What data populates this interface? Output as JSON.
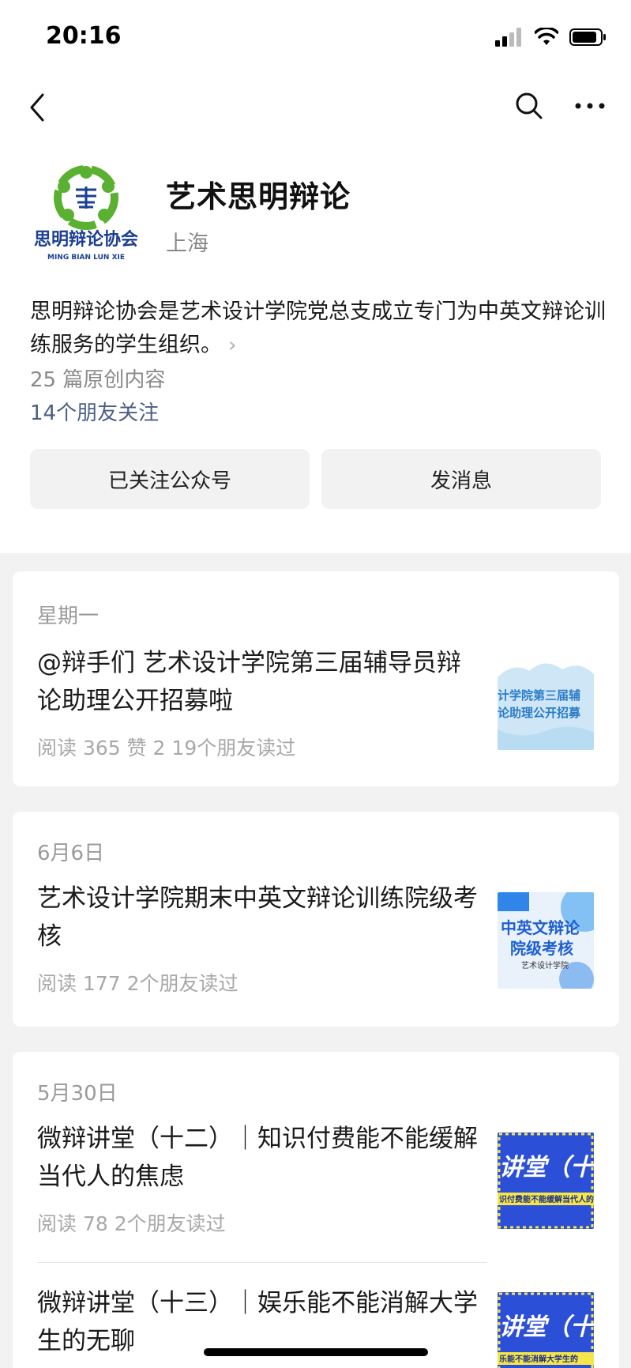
{
  "status_bar": {
    "time": "20:16"
  },
  "account": {
    "name": "艺术思明辩论",
    "region": "上海",
    "logo_text": "思明辩论协会",
    "logo_subtext": "MING BIAN LUN XIE",
    "description": "思明辩论协会是艺术设计学院党总支成立专门为中英文辩论训练服务的学生组织。",
    "original_count": "25 篇原创内容",
    "friends_following": "14个朋友关注"
  },
  "buttons": {
    "follow": "已关注公众号",
    "message": "发消息"
  },
  "articles": [
    {
      "date": "星期一",
      "title": "@辩手们 艺术设计学院第三届辅导员辩论助理公开招募啦",
      "meta": "阅读 365   赞 2   19个朋友读过",
      "thumb_lines": [
        "计学院第三届辅",
        "论助理公开招募"
      ]
    },
    {
      "date": "6月6日",
      "title": "艺术设计学院期末中英文辩论训练院级考核",
      "meta": "阅读 177   2个朋友读过",
      "thumb_lines": [
        "中英文辩论",
        "院级考核",
        "艺术设计学院"
      ]
    },
    {
      "date": "5月30日",
      "title": "微辩讲堂（十二）｜知识付费能不能缓解当代人的焦虑",
      "meta": "阅读 78   2个朋友读过",
      "thumb_lines": [
        "讲堂（十",
        "识付费能不能缓解当代人的"
      ]
    },
    {
      "title": "微辩讲堂（十三）｜娱乐能不能消解大学生的无聊",
      "thumb_lines": [
        "讲堂（十",
        "乐能不能消解大学生的"
      ]
    }
  ],
  "colors": {
    "accent_link": "#4a5f86",
    "muted": "#9a9a9a",
    "feed_bg": "#f2f2f2",
    "logo_blue": "#1c3f94",
    "logo_green": "#5ab031"
  }
}
